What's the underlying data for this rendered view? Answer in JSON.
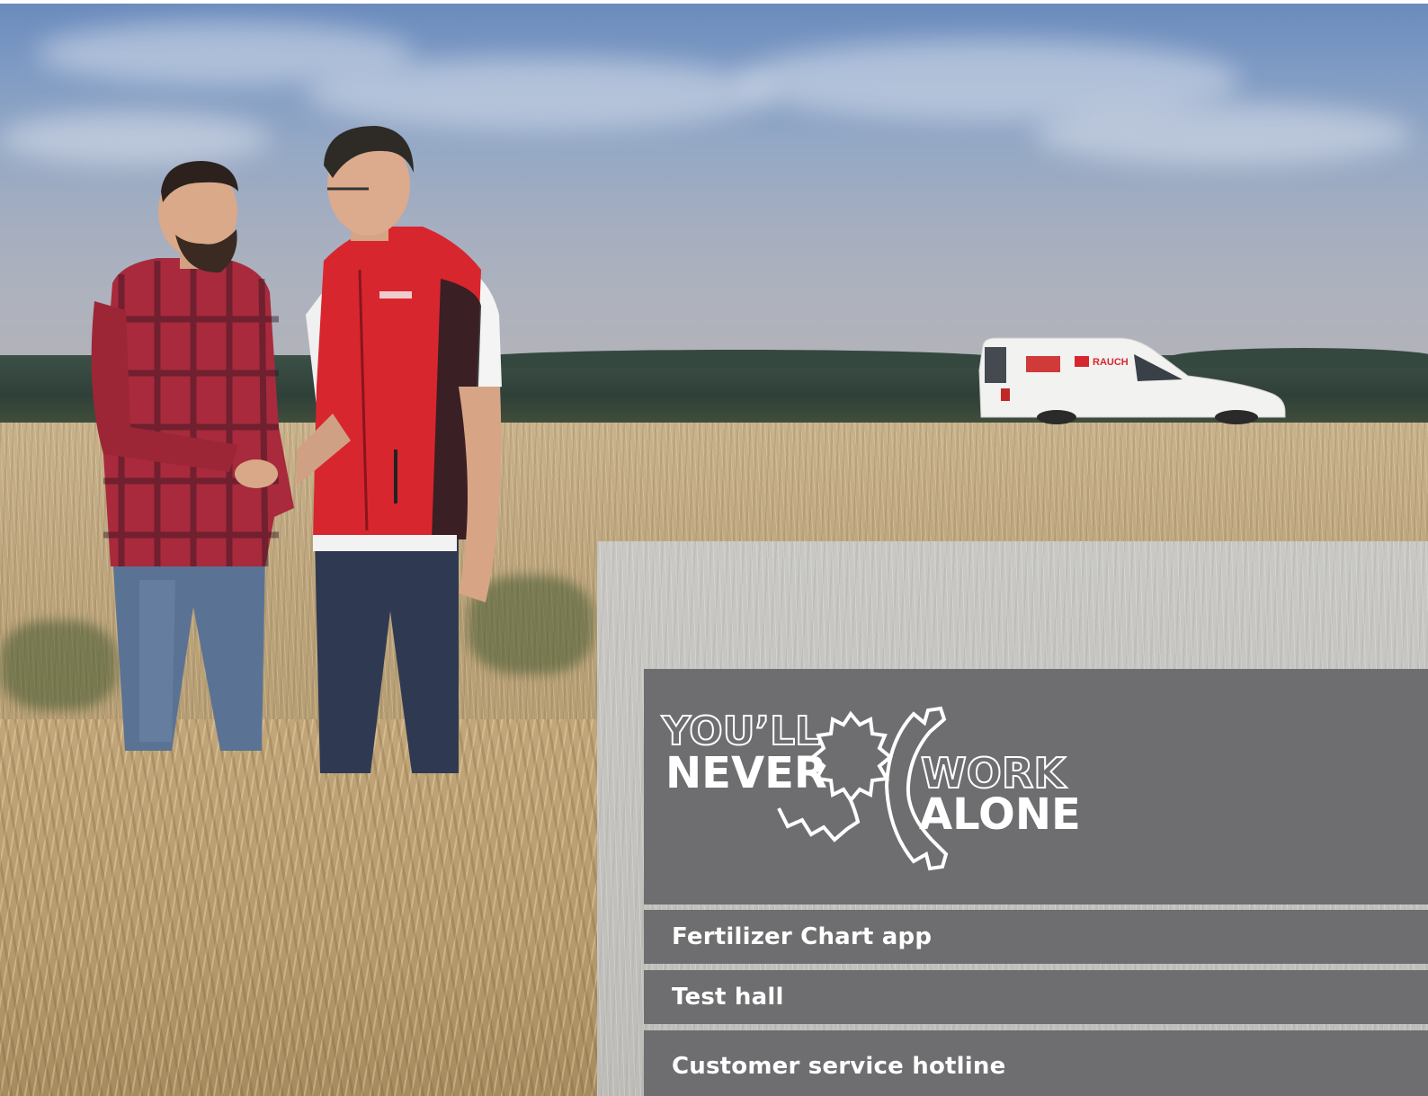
{
  "scene": {
    "description_colors": {
      "sky_top": "#6a8bbd",
      "treeline": "#2f4038",
      "field": "#bca47c",
      "panel_gray": "#6e6e70",
      "vest_red": "#d8262f",
      "shirt_red": "#b02a3c"
    }
  },
  "van": {
    "brand_label": "RAUCH"
  },
  "logo": {
    "line1": "YOU’LL",
    "line2": "NEVER",
    "line3": "WORK",
    "line4": "ALONE"
  },
  "menu": {
    "items": [
      {
        "label": "Fertilizer Chart app"
      },
      {
        "label": "Test hall"
      },
      {
        "label": "Customer service hotline"
      }
    ]
  }
}
